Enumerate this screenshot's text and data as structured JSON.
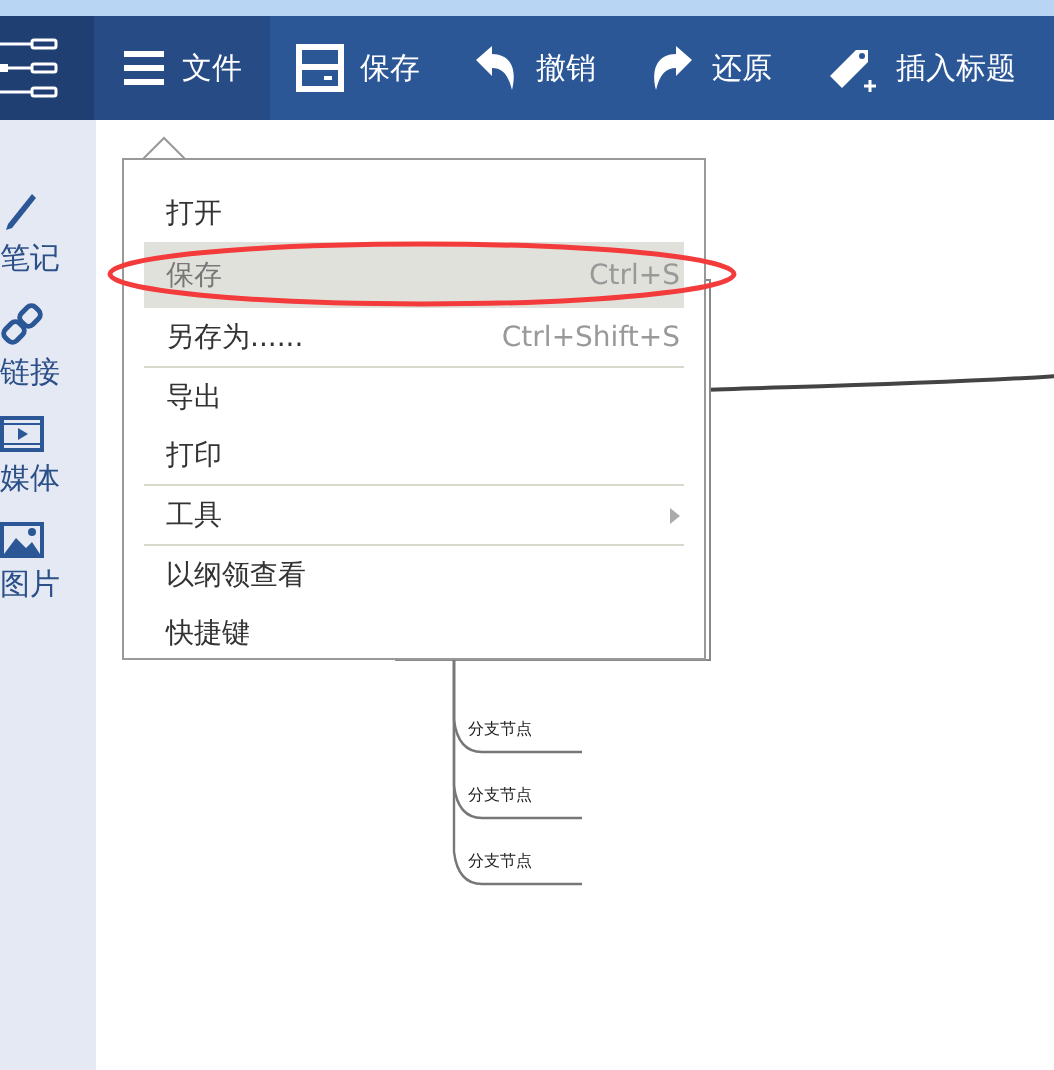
{
  "toolbar": {
    "items": [
      {
        "kind": "file",
        "label": "文件",
        "selected": true
      },
      {
        "kind": "save",
        "label": "保存",
        "selected": false
      },
      {
        "kind": "undo",
        "label": "撤销",
        "selected": false
      },
      {
        "kind": "redo",
        "label": "还原",
        "selected": false
      },
      {
        "kind": "tag",
        "label": "插入标题",
        "selected": false
      }
    ]
  },
  "sidebar": {
    "items": [
      {
        "kind": "pen",
        "label": "笔记"
      },
      {
        "kind": "link",
        "label": "链接"
      },
      {
        "kind": "media",
        "label": "媒体"
      },
      {
        "kind": "image",
        "label": "图片"
      }
    ]
  },
  "menu": {
    "groups": [
      [
        {
          "label": "打开",
          "selected": false
        },
        {
          "label": "保存",
          "shortcut": "Ctrl+S",
          "selected": true
        },
        {
          "label": "另存为......",
          "shortcut": "Ctrl+Shift+S",
          "selected": false
        }
      ],
      [
        {
          "label": "导出",
          "selected": false
        },
        {
          "label": "打印",
          "selected": false
        }
      ],
      [
        {
          "label": "工具",
          "submenu": true,
          "selected": false
        }
      ],
      [
        {
          "label": "以纲领查看",
          "selected": false
        },
        {
          "label": "快捷键",
          "selected": false
        }
      ]
    ]
  },
  "mindmap": {
    "branches": [
      "分支节点",
      "分支节点",
      "分支节点"
    ]
  }
}
